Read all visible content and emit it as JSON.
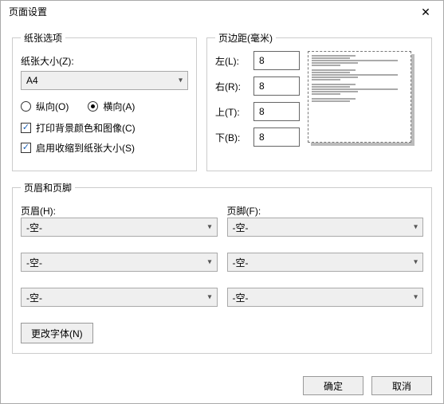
{
  "window": {
    "title": "页面设置",
    "close_label": "✕"
  },
  "paper": {
    "legend": "纸张选项",
    "size_label": "纸张大小(Z):",
    "size_value": "A4",
    "orientation": {
      "portrait_label": "纵向(O)",
      "landscape_label": "横向(A)",
      "value": "landscape"
    },
    "print_bg": {
      "label": "打印背景颜色和图像(C)",
      "checked": true
    },
    "shrink": {
      "label": "启用收缩到纸张大小(S)",
      "checked": true
    }
  },
  "margins": {
    "legend": "页边距(毫米)",
    "left": {
      "label": "左(L):",
      "value": "8"
    },
    "right": {
      "label": "右(R):",
      "value": "8"
    },
    "top": {
      "label": "上(T):",
      "value": "8"
    },
    "bottom": {
      "label": "下(B):",
      "value": "8"
    }
  },
  "hf": {
    "legend": "页眉和页脚",
    "header_label": "页眉(H):",
    "footer_label": "页脚(F):",
    "headers": [
      "-空-",
      "-空-",
      "-空-"
    ],
    "footers": [
      "-空-",
      "-空-",
      "-空-"
    ],
    "change_font_label": "更改字体(N)"
  },
  "dialog": {
    "ok": "确定",
    "cancel": "取消"
  }
}
